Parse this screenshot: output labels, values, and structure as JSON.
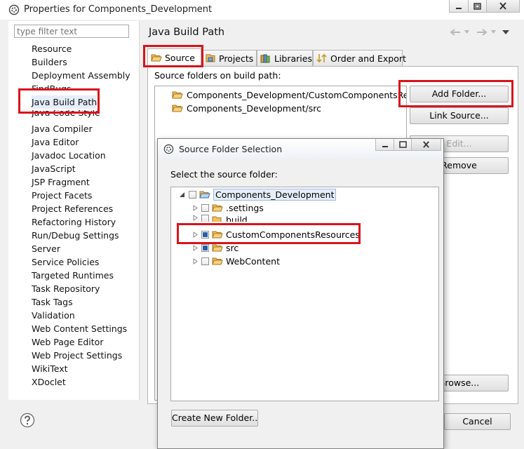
{
  "window": {
    "title": "Properties for Components_Development"
  },
  "filter": {
    "placeholder": "type filter text"
  },
  "nav": {
    "items": [
      "Resource",
      "Builders",
      "Deployment Assembly",
      "FindBugs",
      "Java Build Path",
      "Java Code Style",
      "Java Compiler",
      "Java Editor",
      "Javadoc Location",
      "JavaScript",
      "JSP Fragment",
      "Project Facets",
      "Project References",
      "Refactoring History",
      "Run/Debug Settings",
      "Server",
      "Service Policies",
      "Targeted Runtimes",
      "Task Repository",
      "Task Tags",
      "Validation",
      "Web Content Settings",
      "Web Page Editor",
      "Web Project Settings",
      "WikiText",
      "XDoclet"
    ]
  },
  "page": {
    "title": "Java Build Path"
  },
  "tabs": [
    "Source",
    "Projects",
    "Libraries",
    "Order and Export"
  ],
  "source": {
    "label": "Source folders on build path:",
    "folders": [
      "Components_Development/CustomComponentsResources",
      "Components_Development/src"
    ]
  },
  "buttons": {
    "add_folder": "Add Folder...",
    "link_source": "Link Source...",
    "edit": "Edit...",
    "remove": "Remove",
    "browse": "Browse...",
    "cancel": "Cancel"
  },
  "dialog": {
    "title": "Source Folder Selection",
    "prompt": "Select the source folder:",
    "tree": {
      "root": "Components_Development",
      "children": [
        ".settings",
        "build",
        "CustomComponentsResources",
        "src",
        "WebContent"
      ]
    },
    "create_button": "Create New Folder..."
  },
  "colors": {
    "highlight": "#d8141c",
    "selection": "#e5eef9",
    "checked": "#2a5ea6"
  }
}
